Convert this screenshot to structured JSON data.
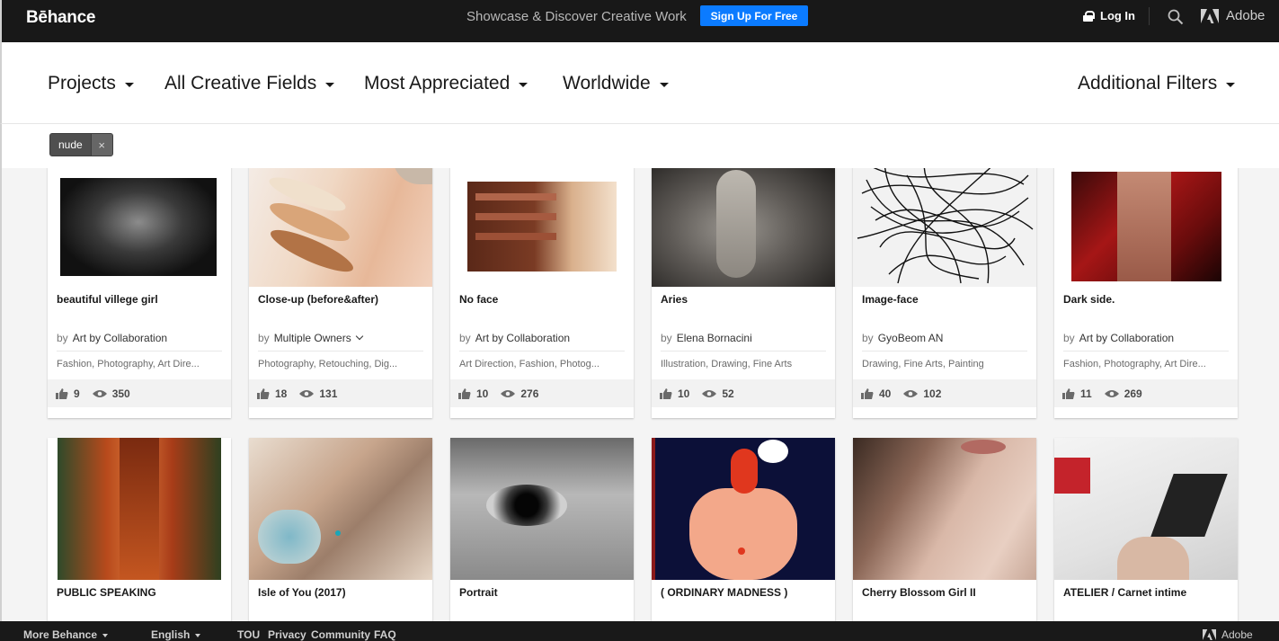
{
  "header": {
    "logo": "Bēhance",
    "tagline": "Showcase & Discover Creative Work",
    "signup_label": "Sign Up For Free",
    "login_label": "Log In",
    "adobe_label": "Adobe"
  },
  "filters": {
    "projects": "Projects",
    "fields": "All Creative Fields",
    "sort": "Most Appreciated",
    "location": "Worldwide",
    "additional": "Additional Filters"
  },
  "tag": {
    "label": "nude",
    "remove": "×"
  },
  "projects": [
    {
      "title": "beautiful villege girl",
      "by": "by",
      "owner": "Art by Collaboration",
      "fields": "Fashion, Photography, Art Dire...",
      "appreciations": "9",
      "views": "350"
    },
    {
      "title": "Close-up (before&after)",
      "by": "by",
      "owner": "Multiple Owners",
      "fields": "Photography, Retouching, Dig...",
      "appreciations": "18",
      "views": "131"
    },
    {
      "title": "No face",
      "by": "by",
      "owner": "Art by Collaboration",
      "fields": "Art Direction, Fashion, Photog...",
      "appreciations": "10",
      "views": "276"
    },
    {
      "title": "Aries",
      "by": "by",
      "owner": "Elena Bornacini",
      "fields": "Illustration, Drawing, Fine Arts",
      "appreciations": "10",
      "views": "52"
    },
    {
      "title": "Image-face",
      "by": "by",
      "owner": "GyoBeom AN",
      "fields": "Drawing, Fine Arts, Painting",
      "appreciations": "40",
      "views": "102"
    },
    {
      "title": "Dark side.",
      "by": "by",
      "owner": "Art by Collaboration",
      "fields": "Fashion, Photography, Art Dire...",
      "appreciations": "11",
      "views": "269"
    },
    {
      "title": "PUBLIC SPEAKING"
    },
    {
      "title": "Isle of You (2017)"
    },
    {
      "title": "Portrait"
    },
    {
      "title": "( ORDINARY MADNESS )"
    },
    {
      "title": "Cherry Blossom Girl II"
    },
    {
      "title": "ATELIER / Carnet intime"
    }
  ],
  "footer": {
    "more": "More Behance",
    "language": "English",
    "tou": "TOU",
    "privacy": "Privacy",
    "community": "Community",
    "faq": "FAQ",
    "adobe": "Adobe"
  },
  "colors": {
    "signup": "#0b7bff",
    "topbar": "#181818"
  }
}
